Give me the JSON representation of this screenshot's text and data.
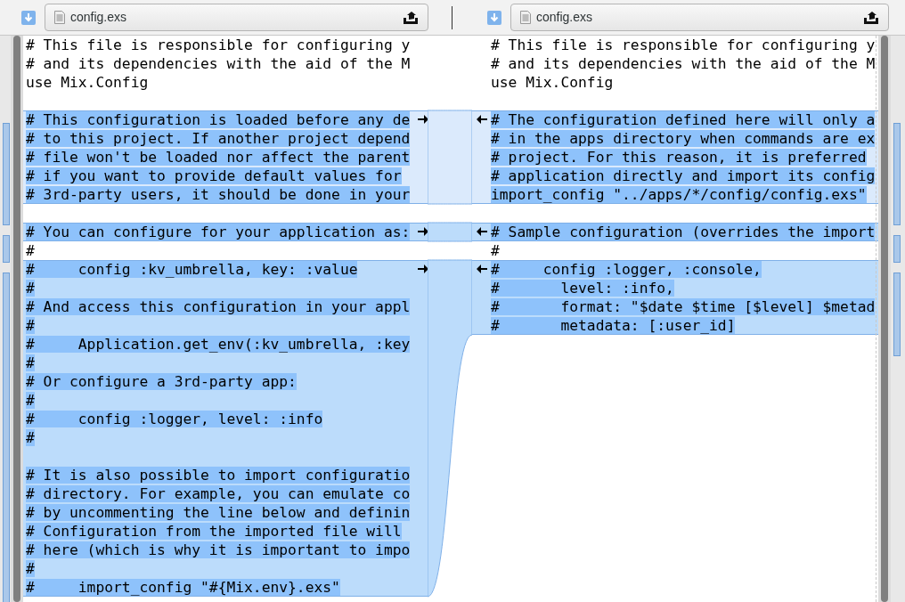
{
  "panes": [
    {
      "file": {
        "name": "config.exs"
      }
    },
    {
      "file": {
        "name": "config.exs"
      }
    }
  ],
  "chunks": [
    {
      "kind": "equal",
      "left_blocks": [
        [
          "# This file is responsible for configuring y",
          "# and its dependencies with the aid of the M",
          "use Mix.Config"
        ]
      ],
      "right_blocks": [
        [
          "# This file is responsible for configuring y",
          "# and its dependencies with the aid of the M",
          "use Mix.Config"
        ]
      ]
    },
    {
      "kind": "gap"
    },
    {
      "kind": "changed",
      "current": true,
      "left_blocks": [
        [
          "# This configuration is loaded before any de",
          "# to this project. If another project depend",
          "# file won't be loaded nor affect the parent",
          "# if you want to provide default values for",
          "# 3rd-party users, it should be done in your"
        ]
      ],
      "right_blocks": [
        [
          "# The configuration defined here will only a",
          "# in the apps directory when commands are ex",
          "# project. For this reason, it is preferred",
          "# application directly and import its config",
          "import_config \"../apps/*/config/config.exs\""
        ]
      ]
    },
    {
      "kind": "gap"
    },
    {
      "kind": "changed",
      "current": false,
      "left_blocks": [
        [
          "# You can configure for your application as:"
        ]
      ],
      "right_blocks": [
        [
          "# Sample configuration (overrides the import"
        ]
      ]
    },
    {
      "kind": "equal",
      "left_blocks": [
        [
          "#"
        ]
      ],
      "right_blocks": [
        [
          "#"
        ]
      ]
    },
    {
      "kind": "changed",
      "current": false,
      "left_blocks": [
        [
          "#     config :kv_umbrella, key: :value",
          "#",
          "# And access this configuration in your appl",
          "#",
          "#     Application.get_env(:kv_umbrella, :key",
          "#",
          "# Or configure a 3rd-party app:",
          "#",
          "#     config :logger, level: :info",
          "#"
        ],
        [
          "# It is also possible to import configuratio",
          "# directory. For example, you can emulate co",
          "# by uncommenting the line below and definin",
          "# Configuration from the imported file will",
          "# here (which is why it is important to impo",
          "#",
          "#     import_config \"#{Mix.env}.exs\""
        ]
      ],
      "right_blocks": [
        [
          "#     config :logger, :console,",
          "#       level: :info,",
          "#       format: \"$date $time [$level] $metad",
          "#       metadata: [:user_id]"
        ]
      ]
    }
  ]
}
